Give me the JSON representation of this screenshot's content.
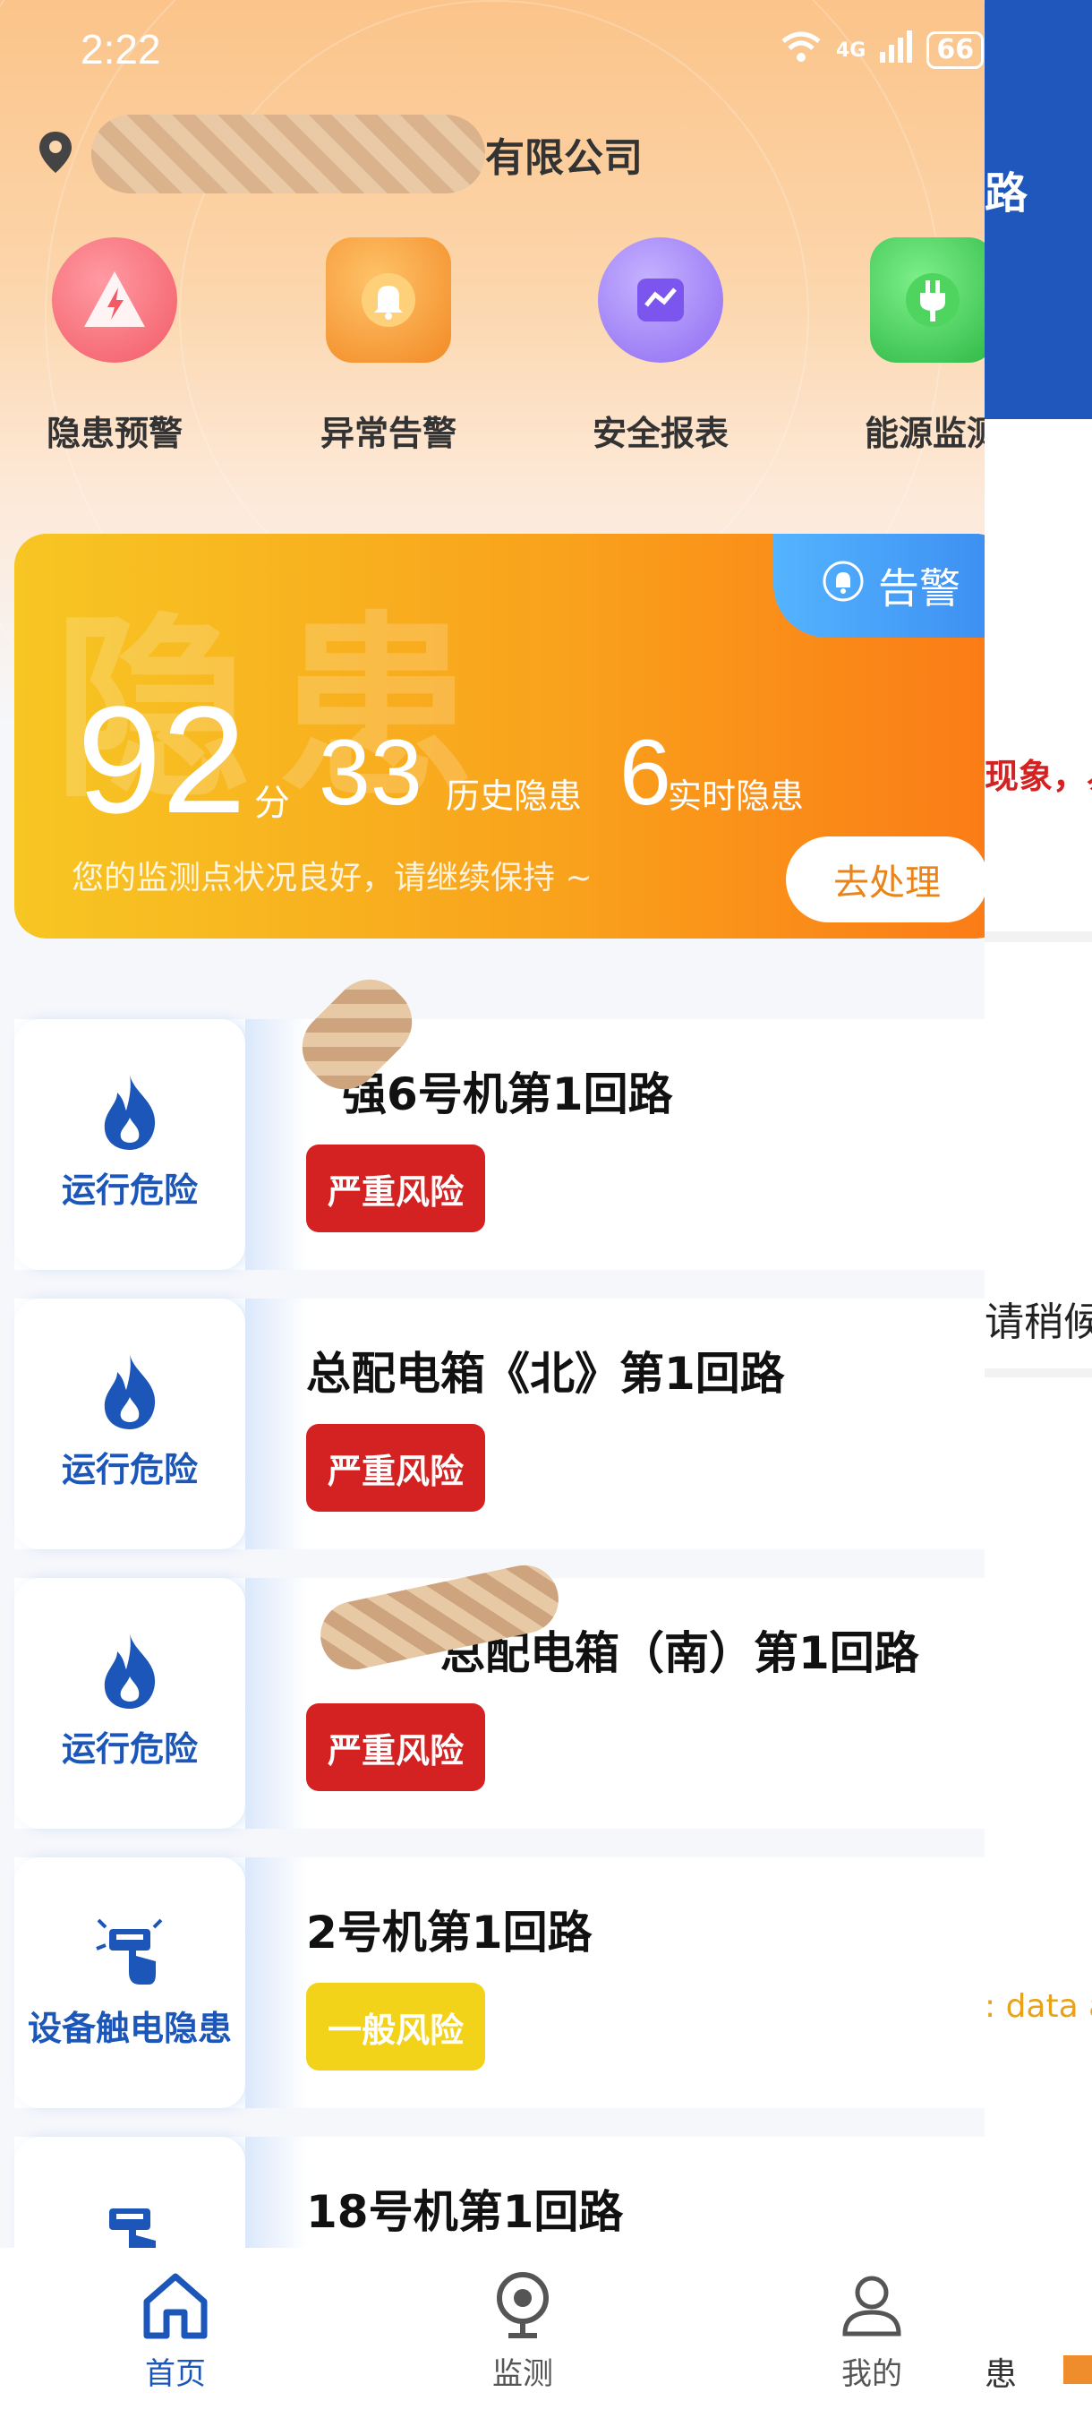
{
  "status_bar": {
    "time": "2:22",
    "network": "4G",
    "battery": "66"
  },
  "location": {
    "company": "有限公司"
  },
  "quick_menu": [
    {
      "label": "隐患预警",
      "icon": "warning-triangle-icon",
      "color": "#f25b66"
    },
    {
      "label": "异常告警",
      "icon": "bell-icon",
      "color": "#f39a2f"
    },
    {
      "label": "安全报表",
      "icon": "chart-line-icon",
      "color": "#8f6bf2"
    },
    {
      "label": "能源监测",
      "icon": "plug-icon",
      "color": "#35c24a"
    }
  ],
  "score_card": {
    "watermark": "隐患",
    "alarm_tab": "告警",
    "score": "92",
    "score_unit": "分",
    "history_count": "33",
    "history_label": "历史隐患",
    "realtime_count": "6",
    "realtime_label": "实时隐患",
    "message": "您的监测点状况良好，请继续保持 ~",
    "action": "去处理"
  },
  "hazards": [
    {
      "category": "运行危险",
      "icon": "flame-icon",
      "title": "强6号机第1回路",
      "risk": "严重风险",
      "risk_color": "#d42121"
    },
    {
      "category": "运行危险",
      "icon": "flame-icon",
      "title": "总配电箱《北》第1回路",
      "risk": "严重风险",
      "risk_color": "#d42121"
    },
    {
      "category": "运行危险",
      "icon": "flame-icon",
      "title": "总配电箱（南）第1回路",
      "risk": "严重风险",
      "risk_color": "#d42121"
    },
    {
      "category": "设备触电隐患",
      "icon": "hand-shock-icon",
      "title": "2号机第1回路",
      "risk": "一般风险",
      "risk_color": "#f3d21a"
    },
    {
      "category": "",
      "icon": "hand-shock-icon",
      "title": "18号机第1回路",
      "risk": "",
      "risk_color": ""
    }
  ],
  "nav": [
    {
      "label": "首页",
      "icon": "home-icon",
      "active": true
    },
    {
      "label": "监测",
      "icon": "camera-icon",
      "active": false
    },
    {
      "label": "我的",
      "icon": "user-icon",
      "active": false
    }
  ],
  "peek_panel": {
    "title_fragment": "路",
    "warning_fragment": "现象，易",
    "wait_fragment": "请稍候",
    "data_fragment": ": data a",
    "bottom_fragment": "患"
  },
  "colors": {
    "accent": "#1b56b8",
    "card_orange": "#fb7a16",
    "card_yellow": "#f7c623"
  }
}
